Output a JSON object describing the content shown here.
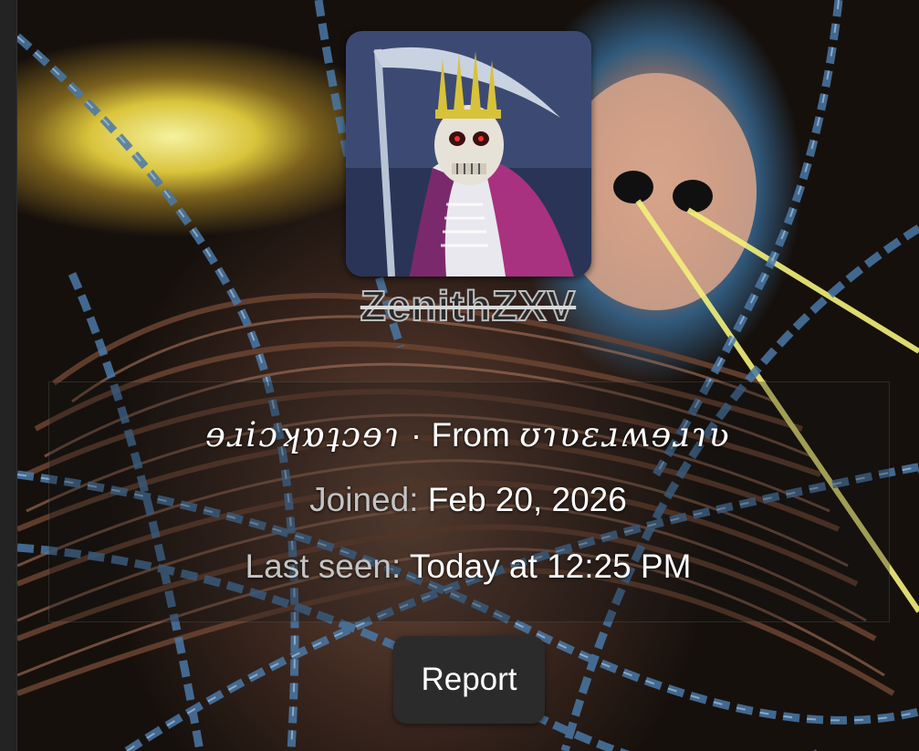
{
  "profile": {
    "username": "ZenithZXV",
    "occupation": "ɘɹiɔʞɒʇɔɘɿ",
    "separator": " · ",
    "from_label": "From",
    "location": "ʊɿʋɛɹʍɘɹɿʋ",
    "joined_label": "Joined:",
    "joined_value": "Feb 20, 2026",
    "last_seen_label": "Last seen:",
    "last_seen_value": "Today at 12:25 PM"
  },
  "actions": {
    "report_label": "Report"
  },
  "colors": {
    "text_primary": "#ffffff",
    "text_muted": "#c4c4c4",
    "button_bg": "#2b2b2b"
  }
}
